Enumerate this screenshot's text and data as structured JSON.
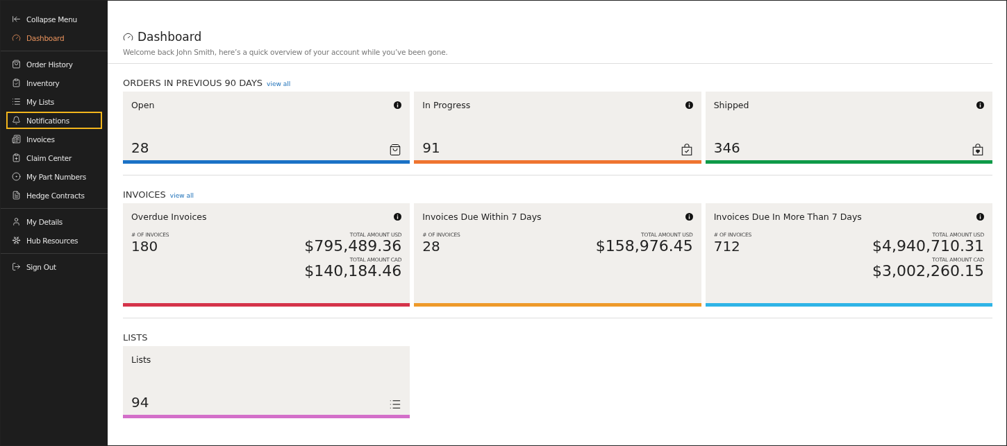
{
  "sidebar": {
    "groups": [
      {
        "items": [
          {
            "label": "Collapse Menu",
            "selected": false,
            "highlighted": false
          },
          {
            "label": "Dashboard",
            "selected": true,
            "highlighted": false
          }
        ]
      },
      {
        "items": [
          {
            "label": "Order History",
            "selected": false,
            "highlighted": false
          },
          {
            "label": "Inventory",
            "selected": false,
            "highlighted": false
          },
          {
            "label": "My Lists",
            "selected": false,
            "highlighted": false
          },
          {
            "label": "Notifications",
            "selected": false,
            "highlighted": true
          },
          {
            "label": "Invoices",
            "selected": false,
            "highlighted": false
          },
          {
            "label": "Claim Center",
            "selected": false,
            "highlighted": false
          },
          {
            "label": "My Part Numbers",
            "selected": false,
            "highlighted": false
          },
          {
            "label": "Hedge Contracts",
            "selected": false,
            "highlighted": false
          }
        ]
      },
      {
        "items": [
          {
            "label": "My Details",
            "selected": false,
            "highlighted": false
          },
          {
            "label": "Hub Resources",
            "selected": false,
            "highlighted": false
          }
        ]
      },
      {
        "items": [
          {
            "label": "Sign Out",
            "selected": false,
            "highlighted": false
          }
        ]
      }
    ]
  },
  "header": {
    "title": "Dashboard",
    "subtitle": "Welcome back John Smith, here’s a quick overview of your account while you’ve been gone."
  },
  "sections": [
    {
      "kind": "count",
      "title": "ORDERS IN PREVIOUS 90 DAYS",
      "link": "view all",
      "cards": [
        {
          "title": "Open",
          "value": "28",
          "color": "#1b72c6"
        },
        {
          "title": "In Progress",
          "value": "91",
          "color": "#ef7430"
        },
        {
          "title": "Shipped",
          "value": "346",
          "color": "#0e9a48"
        }
      ]
    },
    {
      "kind": "invoice",
      "title": "INVOICES",
      "link": "view all",
      "cards": [
        {
          "title": "Overdue Invoices",
          "count_label": "# OF INVOICES",
          "count": "180",
          "amounts": [
            {
              "label": "TOTAL AMOUNT USD",
              "value": "$795,489.36"
            },
            {
              "label": "TOTAL AMOUNT CAD",
              "value": "$140,184.46"
            }
          ],
          "color": "#d5334a"
        },
        {
          "title": "Invoices Due Within 7 Days",
          "count_label": "# OF INVOICES",
          "count": "28",
          "amounts": [
            {
              "label": "TOTAL AMOUNT USD",
              "value": "$158,976.45"
            }
          ],
          "color": "#ee9a2a"
        },
        {
          "title": "Invoices Due In More Than 7 Days",
          "count_label": "# OF INVOICES",
          "count": "712",
          "amounts": [
            {
              "label": "TOTAL AMOUNT USD",
              "value": "$4,940,710.31"
            },
            {
              "label": "TOTAL AMOUNT CAD",
              "value": "$3,002,260.15"
            }
          ],
          "color": "#2fb4e6"
        }
      ]
    },
    {
      "kind": "list",
      "title": "LISTS",
      "cards": [
        {
          "title": "Lists",
          "value": "94",
          "color": "#d36fc9"
        }
      ]
    }
  ]
}
